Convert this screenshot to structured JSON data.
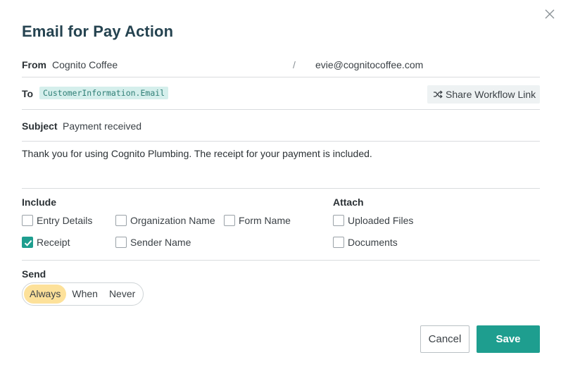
{
  "dialog": {
    "title": "Email for Pay Action",
    "close_icon": "close-icon"
  },
  "from": {
    "label": "From",
    "name": "Cognito Coffee",
    "separator": "/",
    "email": "evie@cognitocoffee.com"
  },
  "to": {
    "label": "To",
    "token": "CustomerInformation.Email",
    "share_button": {
      "icon": "shuffle-icon",
      "label": "Share Workflow Link"
    }
  },
  "subject": {
    "label": "Subject",
    "value": "Payment received"
  },
  "message": {
    "text": "Thank you for using Cognito Plumbing. The receipt for your payment is included."
  },
  "include": {
    "heading": "Include",
    "options": [
      {
        "label": "Entry Details",
        "checked": false
      },
      {
        "label": "Organization Name",
        "checked": false
      },
      {
        "label": "Form Name",
        "checked": false
      },
      {
        "label": "Receipt",
        "checked": true
      },
      {
        "label": "Sender Name",
        "checked": false
      }
    ]
  },
  "attach": {
    "heading": "Attach",
    "options": [
      {
        "label": "Uploaded Files",
        "checked": false
      },
      {
        "label": "Documents",
        "checked": false
      }
    ]
  },
  "send": {
    "heading": "Send",
    "options": [
      "Always",
      "When",
      "Never"
    ],
    "selected": "Always"
  },
  "footer": {
    "cancel_label": "Cancel",
    "save_label": "Save"
  },
  "colors": {
    "accent": "#1e9e8f",
    "token_bg": "#d5efec",
    "selected_segment": "#fde19a",
    "title": "#254350"
  }
}
